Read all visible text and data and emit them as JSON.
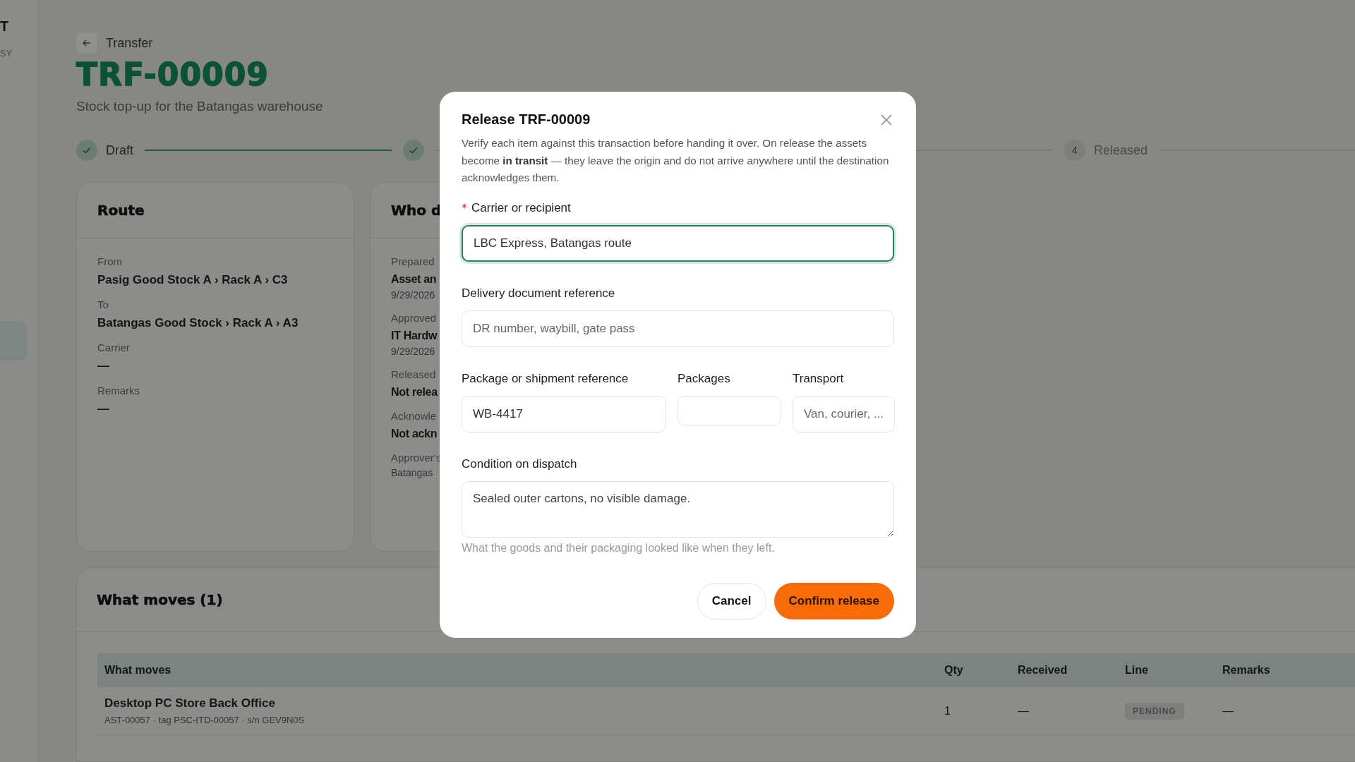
{
  "sidebar": {
    "brand": "T",
    "tagline": "SY"
  },
  "header": {
    "back_label": "Transfer",
    "title": "TRF-00009",
    "subtitle": "Stock top-up for the Batangas warehouse"
  },
  "stepper": [
    {
      "done": true,
      "label": "Draft"
    },
    {
      "done": true
    },
    {
      "done": false,
      "number": "4",
      "label": "Released"
    }
  ],
  "route": {
    "title": "Route",
    "fields": [
      {
        "label": "From",
        "value": "Pasig Good Stock A › Rack A › C3"
      },
      {
        "label": "To",
        "value": "Batangas Good Stock › Rack A › A3"
      },
      {
        "label": "Carrier",
        "value": "—"
      },
      {
        "label": "Remarks",
        "value": "—"
      }
    ]
  },
  "who": {
    "title": "Who d",
    "entries": [
      {
        "label": "Prepared",
        "value": "Asset an",
        "date": "9/29/2026"
      },
      {
        "label": "Approved",
        "value": "IT Hardw",
        "date": "9/29/2026"
      },
      {
        "label": "Released",
        "value": "Not relea"
      },
      {
        "label": "Acknowle",
        "value": "Not ackn"
      },
      {
        "label": "Approver's",
        "date": "Batangas"
      }
    ]
  },
  "moves": {
    "title": "What moves (1)",
    "columns": [
      "What moves",
      "Qty",
      "Received",
      "Line",
      "Remarks"
    ],
    "rows": [
      {
        "name": "Desktop PC Store Back Office",
        "detail": "AST-00057 · tag PSC-ITD-00057 · s/n GEV9N0S",
        "qty": "1",
        "received": "—",
        "line": "PENDING",
        "remarks": "—"
      }
    ]
  },
  "dialog": {
    "title": "Release TRF-00009",
    "description": "Verify each item against this transaction before handing it over. On release the assets become **in transit** — they leave the origin and do not arrive anywhere until the destination acknowledges them.",
    "fields": [
      {
        "label": "Carrier or recipient",
        "required": true,
        "focused": true,
        "value": "LBC Express, Batangas route"
      },
      {
        "label": "Delivery document reference",
        "required": false,
        "focused": false,
        "placeholder": "DR number, waybill, gate pass"
      }
    ],
    "row_fields": [
      {
        "label": "Package or shipment reference",
        "value": "WB-4417"
      },
      {
        "label": "Packages"
      },
      {
        "label": "Transport",
        "placeholder": "Van, courier, ..."
      }
    ],
    "condition": {
      "label": "Condition on dispatch",
      "value": "Sealed outer cartons, no visible damage.",
      "help": "What the goods and their packaging looked like when they left."
    },
    "buttons": [
      {
        "kind": "secondary",
        "label": "Cancel"
      },
      {
        "kind": "primary",
        "label": "Confirm release"
      }
    ]
  }
}
